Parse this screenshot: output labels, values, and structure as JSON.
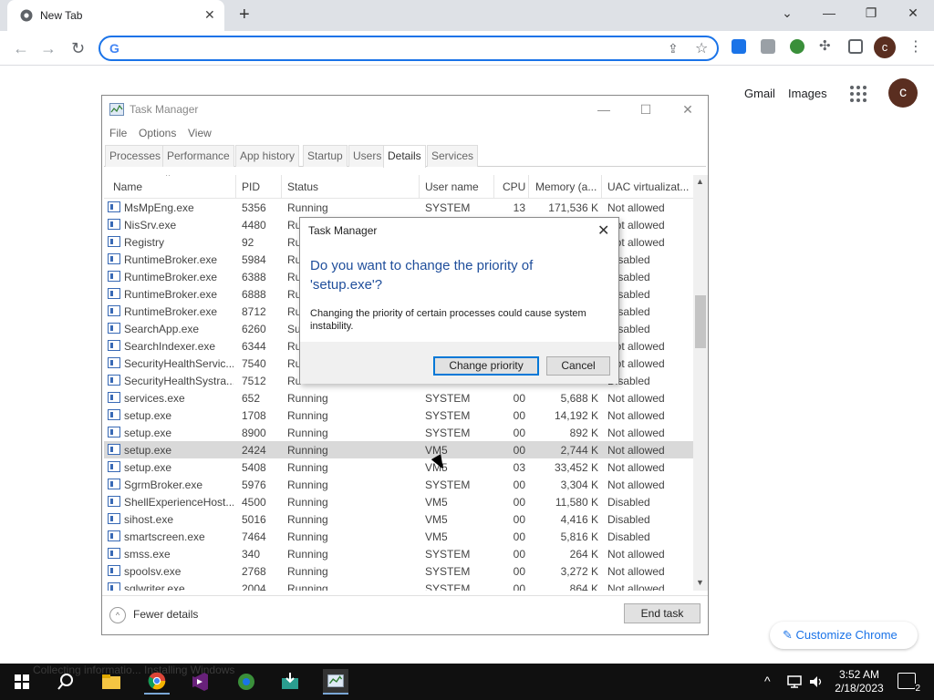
{
  "browser": {
    "tab_title": "New Tab",
    "tab_close": "✕",
    "new_tab": "+",
    "window_controls": {
      "dropdown": "⌄",
      "minimize": "—",
      "restore": "❐",
      "close": "✕"
    },
    "omnibox_value": "",
    "profile_initial": "c",
    "colors": {
      "accent": "#1a73e8",
      "profile": "#5a2e20"
    }
  },
  "ntp": {
    "gmail": "Gmail",
    "images": "Images",
    "avatar": "c",
    "customize": "Customize Chrome"
  },
  "taskmanager": {
    "title": "Task Manager",
    "menu": [
      "File",
      "Options",
      "View"
    ],
    "tabs": [
      "Processes",
      "Performance",
      "App history",
      "Startup",
      "Users",
      "Details",
      "Services"
    ],
    "active_tab": "Details",
    "columns": [
      "Name",
      "PID",
      "Status",
      "User name",
      "CPU",
      "Memory (a...",
      "UAC virtualizat..."
    ],
    "rows": [
      [
        "MsMpEng.exe",
        "5356",
        "Running",
        "SYSTEM",
        "13",
        "171,536 K",
        "Not allowed"
      ],
      [
        "NisSrv.exe",
        "4480",
        "Ru",
        "",
        "",
        "",
        "Not allowed"
      ],
      [
        "Registry",
        "92",
        "Ru",
        "",
        "",
        "",
        "Not allowed"
      ],
      [
        "RuntimeBroker.exe",
        "5984",
        "Ru",
        "",
        "",
        "",
        "Disabled"
      ],
      [
        "RuntimeBroker.exe",
        "6388",
        "Ru",
        "",
        "",
        "",
        "Disabled"
      ],
      [
        "RuntimeBroker.exe",
        "6888",
        "Ru",
        "",
        "",
        "",
        "Disabled"
      ],
      [
        "RuntimeBroker.exe",
        "8712",
        "Ru",
        "",
        "",
        "",
        "Disabled"
      ],
      [
        "SearchApp.exe",
        "6260",
        "Su",
        "",
        "",
        "",
        "Disabled"
      ],
      [
        "SearchIndexer.exe",
        "6344",
        "Ru",
        "",
        "",
        "",
        "Not allowed"
      ],
      [
        "SecurityHealthServic...",
        "7540",
        "Ru",
        "",
        "",
        "",
        "Not allowed"
      ],
      [
        "SecurityHealthSystra...",
        "7512",
        "Ru",
        "",
        "",
        "",
        "Disabled"
      ],
      [
        "services.exe",
        "652",
        "Running",
        "SYSTEM",
        "00",
        "5,688 K",
        "Not allowed"
      ],
      [
        "setup.exe",
        "1708",
        "Running",
        "SYSTEM",
        "00",
        "14,192 K",
        "Not allowed"
      ],
      [
        "setup.exe",
        "8900",
        "Running",
        "SYSTEM",
        "00",
        "892 K",
        "Not allowed"
      ],
      [
        "setup.exe",
        "2424",
        "Running",
        "VM5",
        "00",
        "2,744 K",
        "Not allowed"
      ],
      [
        "setup.exe",
        "5408",
        "Running",
        "VM5",
        "03",
        "33,452 K",
        "Not allowed"
      ],
      [
        "SgrmBroker.exe",
        "5976",
        "Running",
        "SYSTEM",
        "00",
        "3,304 K",
        "Not allowed"
      ],
      [
        "ShellExperienceHost....",
        "4500",
        "Running",
        "VM5",
        "00",
        "11,580 K",
        "Disabled"
      ],
      [
        "sihost.exe",
        "5016",
        "Running",
        "VM5",
        "00",
        "4,416 K",
        "Disabled"
      ],
      [
        "smartscreen.exe",
        "7464",
        "Running",
        "VM5",
        "00",
        "5,816 K",
        "Disabled"
      ],
      [
        "smss.exe",
        "340",
        "Running",
        "SYSTEM",
        "00",
        "264 K",
        "Not allowed"
      ],
      [
        "spoolsv.exe",
        "2768",
        "Running",
        "SYSTEM",
        "00",
        "3,272 K",
        "Not allowed"
      ],
      [
        "sqlwriter.exe",
        "2004",
        "Running",
        "SYSTEM",
        "00",
        "864 K",
        "Not allowed"
      ]
    ],
    "selected_index": 14,
    "fewer_details": "Fewer details",
    "end_task": "End task"
  },
  "dialog": {
    "title": "Task Manager",
    "close": "✕",
    "main": "Do you want to change the priority of 'setup.exe'?",
    "sub": "Changing the priority of certain processes could cause system instability.",
    "confirm": "Change priority",
    "cancel": "Cancel"
  },
  "taskbar": {
    "ghost_text": "Collecting informatio...        Installing Windows",
    "time": "3:52 AM",
    "date": "2/18/2023",
    "notification_count": "2"
  }
}
